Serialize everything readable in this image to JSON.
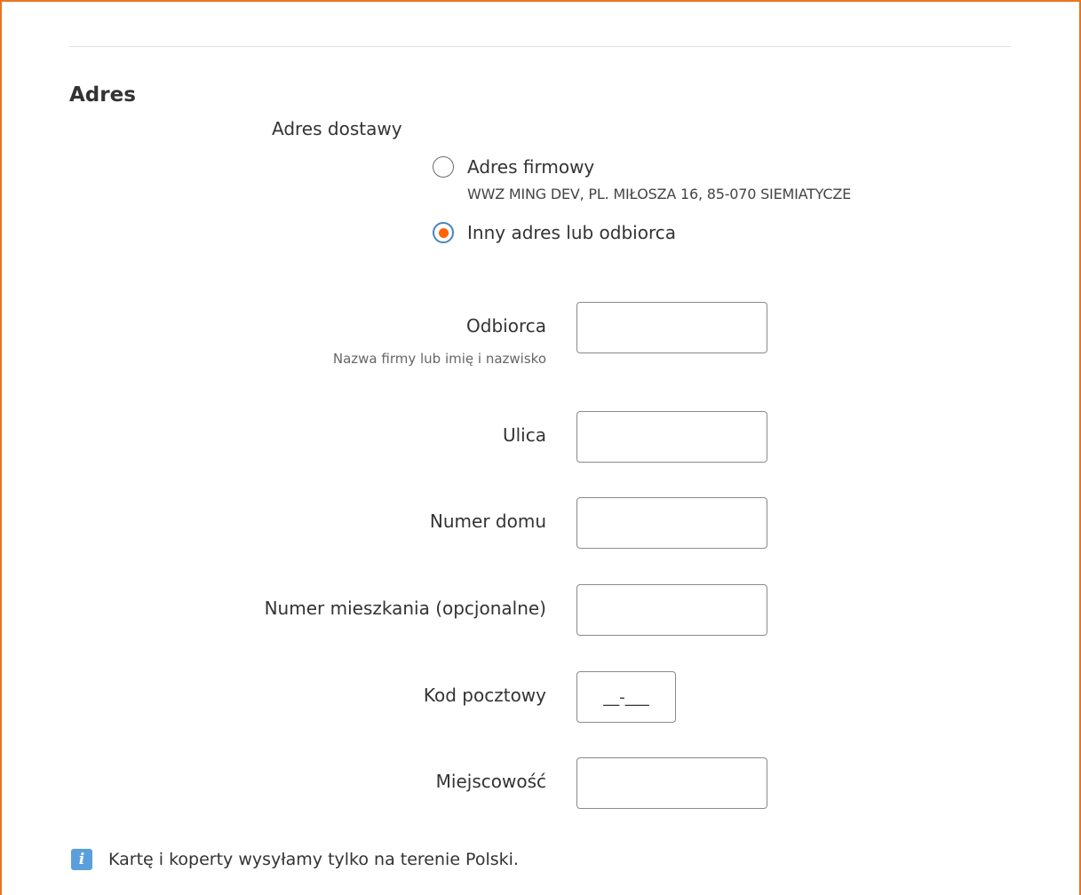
{
  "section": {
    "title": "Adres"
  },
  "delivery": {
    "label": "Adres dostawy",
    "options": [
      {
        "label": "Adres firmowy",
        "sublabel": "WWZ MING DEV, PL. MIŁOSZA 16, 85-070 SIEMIATYCZE",
        "selected": false
      },
      {
        "label": "Inny adres lub odbiorca",
        "selected": true
      }
    ]
  },
  "fields": {
    "recipient": {
      "label": "Odbiorca",
      "hint": "Nazwa firmy lub imię i nazwisko",
      "value": ""
    },
    "street": {
      "label": "Ulica",
      "value": ""
    },
    "house_number": {
      "label": "Numer domu",
      "value": ""
    },
    "apartment_number": {
      "label": "Numer mieszkania (opcjonalne)",
      "value": ""
    },
    "postal_code": {
      "label": "Kod pocztowy",
      "placeholder": "__-___",
      "value": ""
    },
    "city": {
      "label": "Miejscowość",
      "value": ""
    }
  },
  "notice": {
    "icon": "info-icon",
    "text": "Kartę i koperty wysyłamy tylko na terenie Polski."
  },
  "colors": {
    "accent": "#ff6200",
    "frame": "#e8761e",
    "info": "#5a9fdc",
    "radio_ring_selected": "#4a82c0"
  }
}
